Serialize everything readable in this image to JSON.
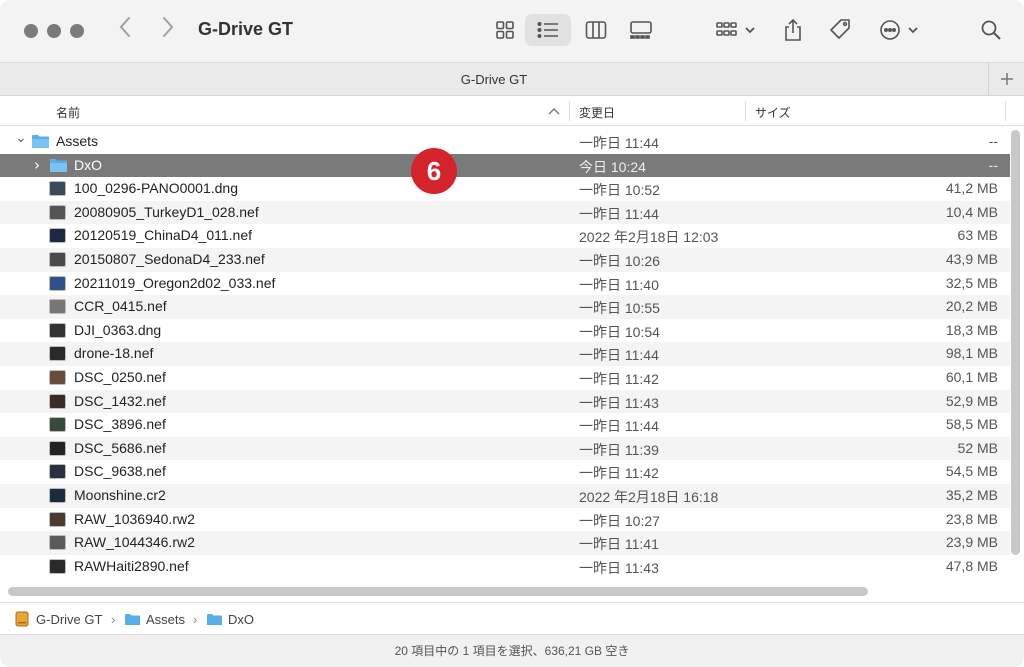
{
  "window": {
    "title": "G-Drive GT",
    "tab_title": "G-Drive GT"
  },
  "colors": {
    "folder": "#5aaee6",
    "selection": "#7a7a7a",
    "badge": "#d3242b"
  },
  "icons": {
    "back": "chevron-left-icon",
    "forward": "chevron-right-icon",
    "add_tab": "plus-icon",
    "search": "search-icon"
  },
  "columns": {
    "name": "名前",
    "date": "変更日",
    "size": "サイズ"
  },
  "badge": "6",
  "rows": [
    {
      "name": "Assets",
      "date": "一昨日 11:44",
      "size": "--",
      "kind": "folder",
      "expanded": true
    },
    {
      "name": "DxO",
      "date": "今日 10:24",
      "size": "--",
      "kind": "folder",
      "selected": true
    },
    {
      "name": "100_0296-PANO0001.dng",
      "date": "一昨日 10:52",
      "size": "41,2 MB",
      "kind": "image"
    },
    {
      "name": "20080905_TurkeyD1_028.nef",
      "date": "一昨日 11:44",
      "size": "10,4 MB",
      "kind": "image"
    },
    {
      "name": "20120519_ChinaD4_011.nef",
      "date": "2022 年2月18日 12:03",
      "size": "63 MB",
      "kind": "image"
    },
    {
      "name": "20150807_SedonaD4_233.nef",
      "date": "一昨日 10:26",
      "size": "43,9 MB",
      "kind": "image"
    },
    {
      "name": "20211019_Oregon2d02_033.nef",
      "date": "一昨日 11:40",
      "size": "32,5 MB",
      "kind": "image"
    },
    {
      "name": "CCR_0415.nef",
      "date": "一昨日 10:55",
      "size": "20,2 MB",
      "kind": "image"
    },
    {
      "name": "DJI_0363.dng",
      "date": "一昨日 10:54",
      "size": "18,3 MB",
      "kind": "image"
    },
    {
      "name": "drone-18.nef",
      "date": "一昨日 11:44",
      "size": "98,1 MB",
      "kind": "image"
    },
    {
      "name": "DSC_0250.nef",
      "date": "一昨日 11:42",
      "size": "60,1 MB",
      "kind": "image"
    },
    {
      "name": "DSC_1432.nef",
      "date": "一昨日 11:43",
      "size": "52,9 MB",
      "kind": "image"
    },
    {
      "name": "DSC_3896.nef",
      "date": "一昨日 11:44",
      "size": "58,5 MB",
      "kind": "image"
    },
    {
      "name": "DSC_5686.nef",
      "date": "一昨日 11:39",
      "size": "52 MB",
      "kind": "image"
    },
    {
      "name": "DSC_9638.nef",
      "date": "一昨日 11:42",
      "size": "54,5 MB",
      "kind": "image"
    },
    {
      "name": "Moonshine.cr2",
      "date": "2022 年2月18日 16:18",
      "size": "35,2 MB",
      "kind": "image"
    },
    {
      "name": "RAW_1036940.rw2",
      "date": "一昨日 10:27",
      "size": "23,8 MB",
      "kind": "image"
    },
    {
      "name": "RAW_1044346.rw2",
      "date": "一昨日 11:41",
      "size": "23,9 MB",
      "kind": "image"
    },
    {
      "name": "RAWHaiti2890.nef",
      "date": "一昨日 11:43",
      "size": "47,8 MB",
      "kind": "image"
    }
  ],
  "pathbar": {
    "drive": "G-Drive GT",
    "folder1": "Assets",
    "folder2": "DxO",
    "separator": "›"
  },
  "status": "20 項目中の 1 項目を選択、636,21 GB 空き"
}
